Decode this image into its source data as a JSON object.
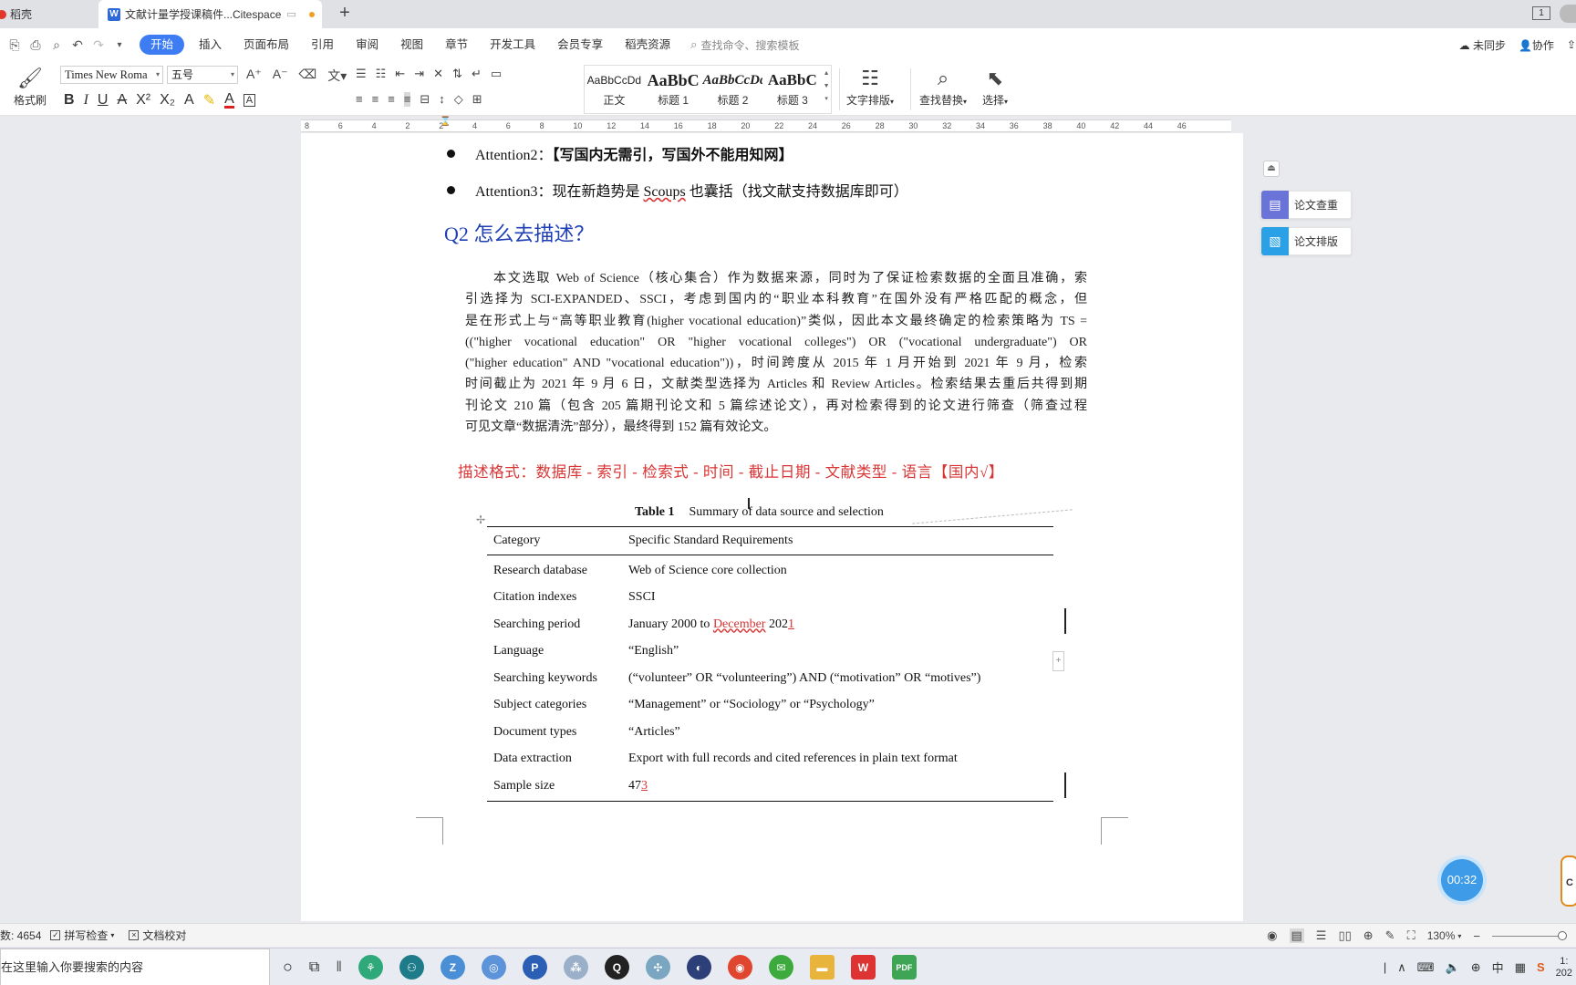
{
  "tabs": [
    {
      "label": "稻壳"
    },
    {
      "label": "文献计量学授课稿件...Citespace"
    }
  ],
  "window": {
    "badge": "1"
  },
  "quick_access": [
    "save-icon",
    "print-icon",
    "print-preview-icon",
    "undo-icon",
    "redo-icon",
    "more-icon"
  ],
  "menu": {
    "items": [
      "开始",
      "插入",
      "页面布局",
      "引用",
      "审阅",
      "视图",
      "章节",
      "开发工具",
      "会员专享",
      "稻壳资源"
    ],
    "active": "开始",
    "search_placeholder": "查找命令、搜索模板",
    "unsynced": "未同步",
    "collab": "协作"
  },
  "ribbon": {
    "format_brush": "格式刷",
    "font_name": "Times New Roma",
    "font_size": "五号",
    "styles": [
      {
        "preview": "AaBbCcDd",
        "name": "正文"
      },
      {
        "preview": "AaBbC",
        "name": "标题 1"
      },
      {
        "preview": "AaBbCcDd",
        "name": "标题 2"
      },
      {
        "preview": "AaBbC",
        "name": "标题 3"
      }
    ],
    "text_layout": "文字排版",
    "find_replace": "查找替换",
    "select": "选择"
  },
  "ruler_ticks": [
    "8",
    "6",
    "4",
    "2",
    "2",
    "4",
    "6",
    "8",
    "10",
    "12",
    "14",
    "16",
    "18",
    "20",
    "22",
    "24",
    "26",
    "28",
    "30",
    "32",
    "34",
    "36",
    "38",
    "40",
    "42",
    "44",
    "46"
  ],
  "document": {
    "attention2_label": "Attention2：",
    "attention2_text": "【写国内无需引，写国外不能用知网】",
    "attention3_label": "Attention3：",
    "attention3_text_a": "现在新趋势是 ",
    "attention3_scoups": "Scoups",
    "attention3_text_b": " 也囊括（找文献支持数据库即可）",
    "q2_heading": "Q2 怎么去描述？",
    "paragraph_lines": [
      "本文选取 Web of Science（核心集合）作为数据来源，同时为了保证检索数据的全面且准确，索",
      "引选择为 SCI-EXPANDED、SSCI，考虑到国内的“职业本科教育”在国外没有严格匹配的概念，但",
      "是在形式上与“高等职业教育(higher vocational education)”类似，因此本文最终确定的检索策略为 TS =",
      "((\"higher vocational education\" OR \"higher vocational colleges\") OR (\"vocational undergraduate\") OR",
      "(\"higher education\" AND \"vocational education\"))，时间跨度从 2015 年 1 月开始到 2021 年 9 月，检索",
      "时间截止为 2021 年 9 月 6 日，文献类型选择为 Articles 和 Review Articles。检索结果去重后共得到期",
      "刊论文 210 篇（包含 205 篇期刊论文和 5 篇综述论文），再对检索得到的论文进行筛查（筛查过程",
      "可见文章“数据清洗”部分），最终得到 152 篇有效论文。"
    ],
    "format_line": "描述格式：数据库 - 索引 - 检索式 - 时间 - 截止日期 - 文献类型 - 语言【国内√】",
    "table": {
      "caption_label": "Table 1",
      "caption_text": "Summary of data source and selection",
      "header": [
        "Category",
        "Specific Standard Requirements"
      ],
      "rows": [
        {
          "category": "Research database",
          "value": "Web of Science core collection"
        },
        {
          "category": "Citation indexes",
          "value": "SSCI"
        },
        {
          "category": "Searching period",
          "value_a": "January 2000 to ",
          "value_red": "December",
          "value_b": " 202",
          "value_tail": "1"
        },
        {
          "category": "Language",
          "value": "“English”"
        },
        {
          "category": "Searching keywords",
          "value": "(“volunteer” OR “volunteering”) AND (“motivation” OR “motives”)"
        },
        {
          "category": "Subject categories",
          "value": "“Management” or “Sociology” or “Psychology”"
        },
        {
          "category": "Document types",
          "value": "“Articles”"
        },
        {
          "category": "Data extraction",
          "value": "Export with full records and cited references in plain text format"
        },
        {
          "category": "Sample size",
          "value_a": "47",
          "value_tail": "3"
        }
      ]
    }
  },
  "side_panel": {
    "check": "论文查重",
    "layout": "论文排版"
  },
  "timer": "00:32",
  "side_char": "C",
  "statusbar": {
    "word_count": "数: 4654",
    "spell_check": "拼写检查",
    "doc_proof": "文档校对",
    "zoom": "130%"
  },
  "taskbar": {
    "search_placeholder": "在这里输入你要搜索的内容"
  },
  "colors": {
    "accent": "#3e7cf4",
    "heading_blue": "#1f3fb5",
    "format_red": "#d83535",
    "timer_blue": "#3d9be8"
  }
}
